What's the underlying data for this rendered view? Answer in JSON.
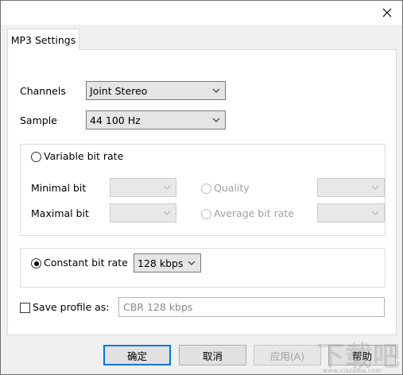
{
  "tab": {
    "label": "MP3 Settings"
  },
  "channels": {
    "label": "Channels",
    "value": "Joint Stereo"
  },
  "sample": {
    "label": "Sample",
    "value": "44 100 Hz"
  },
  "variable": {
    "radio_label": "Variable bit rate",
    "minimal_label": "Minimal bit",
    "maximal_label": "Maximal bit",
    "quality_label": "Quality",
    "average_label": "Average bit rate"
  },
  "constant": {
    "radio_label": "Constant bit rate",
    "value": "128 kbps"
  },
  "profile": {
    "label": "Save profile as:",
    "placeholder": "CBR 128 kbps"
  },
  "buttons": {
    "ok": "确定",
    "cancel": "取消",
    "apply": "应用(A)",
    "help": "帮助"
  },
  "watermark": {
    "text": "下载吧",
    "url": "www.xiazaiba.com"
  }
}
